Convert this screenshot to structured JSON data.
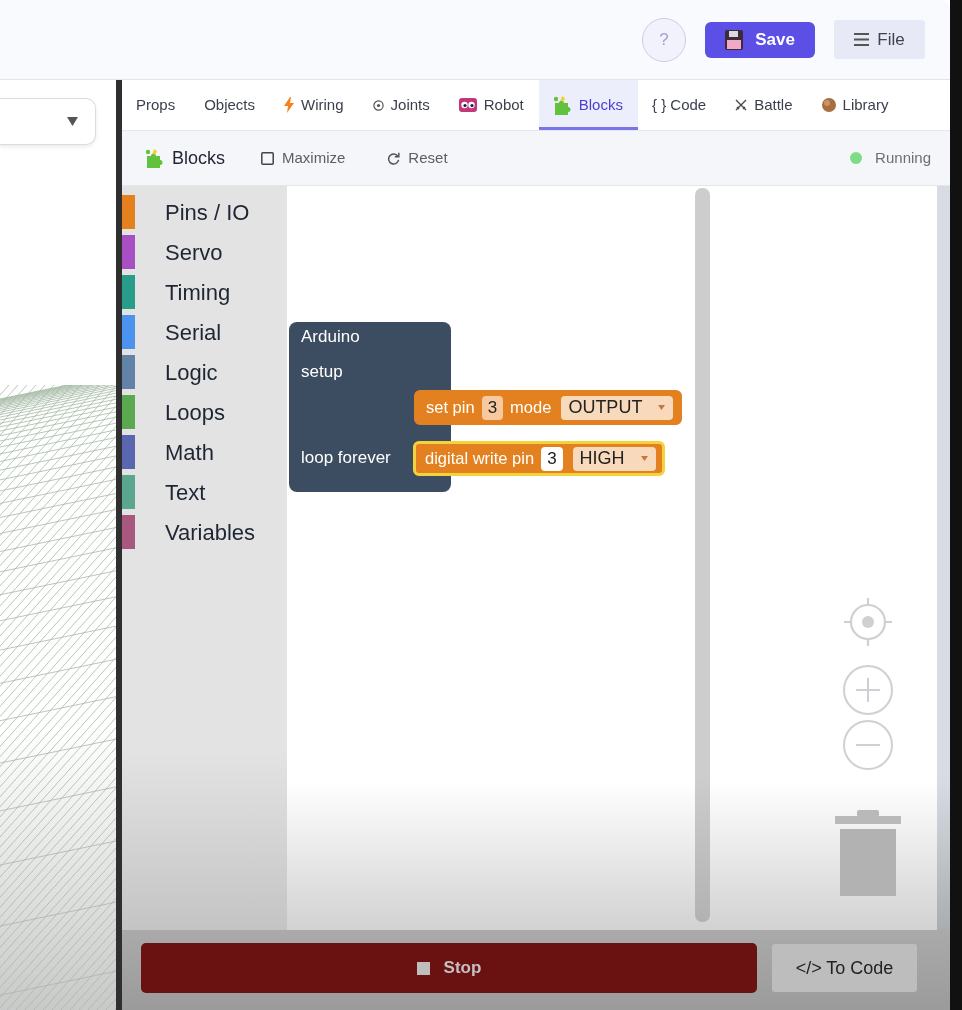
{
  "header": {
    "help_button": "?",
    "save_button": "Save",
    "file_button": "File"
  },
  "tabs": [
    {
      "label": "Props",
      "selected": false
    },
    {
      "label": "Objects",
      "selected": false
    },
    {
      "label": "Wiring",
      "selected": false
    },
    {
      "label": "Joints",
      "selected": false
    },
    {
      "label": "Robot",
      "selected": false
    },
    {
      "label": "Blocks",
      "selected": true
    },
    {
      "label": "{ } Code",
      "selected": false
    },
    {
      "label": "Battle",
      "selected": false
    },
    {
      "label": "Library",
      "selected": false
    }
  ],
  "toolbar": {
    "title": "Blocks",
    "maximize_button": "Maximize",
    "reset_button": "Reset",
    "status": {
      "label": "Running",
      "running": true
    }
  },
  "toolbox": {
    "categories": [
      {
        "label": "Pins / IO",
        "color": "#e5801e"
      },
      {
        "label": "Servo",
        "color": "#a84fc4"
      },
      {
        "label": "Timing",
        "color": "#2a9d8a"
      },
      {
        "label": "Serial",
        "color": "#4b93ef"
      },
      {
        "label": "Logic",
        "color": "#6382a8"
      },
      {
        "label": "Loops",
        "color": "#5aa850"
      },
      {
        "label": "Math",
        "color": "#5a66b0"
      },
      {
        "label": "Text",
        "color": "#5aa68e"
      },
      {
        "label": "Variables",
        "color": "#a8577f"
      }
    ]
  },
  "workspace": {
    "program": {
      "title": "Arduino",
      "setup_label": "setup",
      "loop_label": "loop forever",
      "setup_blocks": [
        {
          "selected": false,
          "parts": [
            {
              "kind": "label",
              "text": "set pin"
            },
            {
              "kind": "number",
              "text": "3",
              "focused": false
            },
            {
              "kind": "label",
              "text": "mode"
            },
            {
              "kind": "dropdown",
              "text": "OUTPUT"
            }
          ]
        }
      ],
      "loop_blocks": [
        {
          "selected": true,
          "parts": [
            {
              "kind": "label",
              "text": "digital write pin"
            },
            {
              "kind": "number",
              "text": "3",
              "focused": true
            },
            {
              "kind": "dropdown",
              "text": "HIGH"
            }
          ]
        }
      ]
    }
  },
  "footer": {
    "stop_button": "Stop",
    "to_code_button": "</> To Code"
  }
}
